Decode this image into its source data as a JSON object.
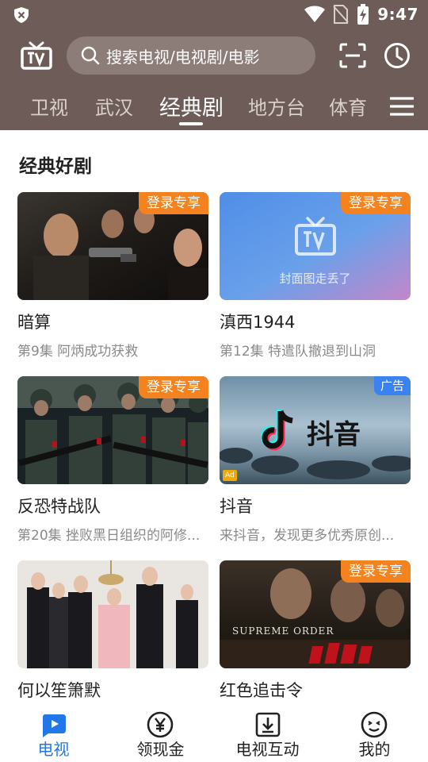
{
  "status_bar": {
    "time": "9:47"
  },
  "search": {
    "placeholder": "搜索电视/电视剧/电影"
  },
  "tabs": [
    {
      "label": "卫视"
    },
    {
      "label": "武汉"
    },
    {
      "label": "经典剧",
      "active": true
    },
    {
      "label": "地方台"
    },
    {
      "label": "体育"
    }
  ],
  "section": {
    "title": "经典好剧"
  },
  "cards": [
    {
      "title": "暗算",
      "subtitle": "第9集 阿炳成功获救",
      "badge": "登录专享"
    },
    {
      "title": "滇西1944",
      "subtitle": "第12集 特遣队撤退到山洞",
      "badge": "登录专享",
      "placeholder_text": "封面图走丢了"
    },
    {
      "title": "反恐特战队",
      "subtitle": "第20集 挫败黑日组织的阿修...",
      "badge": "登录专享"
    },
    {
      "title": "抖音",
      "subtitle": "来抖音，发现更多优秀原创...",
      "badge": "广告",
      "ad_mark": "Ad",
      "brand_text": "抖音"
    },
    {
      "title": "何以笙箫默",
      "subtitle": ""
    },
    {
      "title": "红色追击令",
      "subtitle": "",
      "badge": "登录专享",
      "poster_text": "SUPREME ORDER"
    }
  ],
  "bottom_nav": [
    {
      "label": "电视",
      "icon": "tv-play-icon",
      "active": true
    },
    {
      "label": "领现金",
      "icon": "yen-coin-icon"
    },
    {
      "label": "电视互动",
      "icon": "download-box-icon"
    },
    {
      "label": "我的",
      "icon": "smiley-face-icon"
    }
  ],
  "colors": {
    "header": "#6d5c57",
    "badge": "#f4831f",
    "ad_badge": "#3a82f0",
    "active_nav": "#2277e8"
  }
}
